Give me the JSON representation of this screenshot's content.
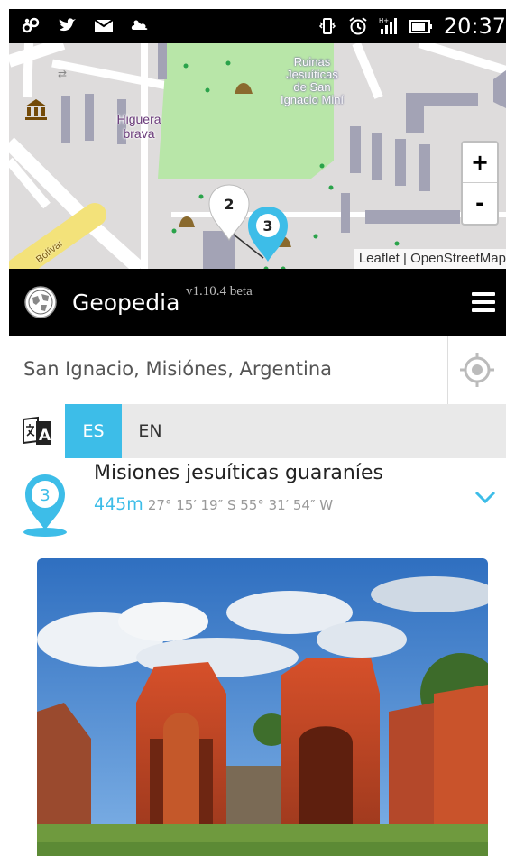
{
  "status_bar": {
    "time": "20:37",
    "icons": [
      "wifi-icon",
      "twitter-icon",
      "mail-icon",
      "cloud-icon",
      "vibrate-icon",
      "alarm-icon",
      "signal-icon",
      "battery-icon"
    ]
  },
  "map": {
    "labels": {
      "higuera": "Higuera brava",
      "ruinas": "Ruinas Jesuíticas de San Ignacio Miní",
      "street": "Bolívar"
    },
    "markers": [
      {
        "number": "2",
        "color": "#ffffff"
      },
      {
        "number": "3",
        "color": "#3dbde8"
      }
    ],
    "zoom_in": "+",
    "zoom_out": "-",
    "attribution_leaflet": "Leaflet",
    "attribution_sep": " | ",
    "attribution_osm": "OpenStreetMap"
  },
  "appbar": {
    "name": "Geopedia",
    "version": "v1.10.4 beta"
  },
  "search": {
    "value": "San Ignacio, Misiónes, Argentina"
  },
  "language": {
    "tabs": [
      {
        "label": "ES",
        "active": true
      },
      {
        "label": "EN",
        "active": false
      }
    ]
  },
  "result": {
    "number": "3",
    "title": "Misiones jesuíticas guaraníes",
    "distance": "445m",
    "coordinates": "27° 15′ 19″ S 55° 31′ 54″ W"
  },
  "colors": {
    "accent": "#3dbde8",
    "park": "#b8e6a8",
    "building": "#a3a3b5"
  }
}
